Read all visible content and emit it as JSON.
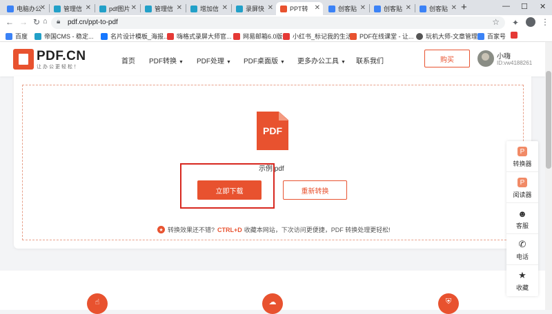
{
  "browser": {
    "tabs": [
      {
        "title": "电脑办公",
        "color": "#3b82f6"
      },
      {
        "title": "管理信",
        "color": "#22a0c8"
      },
      {
        "title": "pdf图片",
        "color": "#22a0c8"
      },
      {
        "title": "管理信",
        "color": "#22a0c8"
      },
      {
        "title": "增加信",
        "color": "#22a0c8"
      },
      {
        "title": "录屏快",
        "color": "#22a0c8"
      },
      {
        "title": "PPT转",
        "color": "#e8522f"
      },
      {
        "title": "创客贴",
        "color": "#3b82f6"
      },
      {
        "title": "创客贴",
        "color": "#3b82f6"
      },
      {
        "title": "创客贴",
        "color": "#3b82f6"
      }
    ],
    "url": "pdf.cn/ppt-to-pdf",
    "bookmarks": [
      {
        "label": "百度",
        "color": "#3b82f6"
      },
      {
        "label": "帝国CMS - 稳定...",
        "color": "#22a0c8"
      },
      {
        "label": "名片设计模板_海报...",
        "color": "#1677ff"
      },
      {
        "label": "嗨格式录屏大师官...",
        "color": "#e53935"
      },
      {
        "label": "网易邮箱6.0版",
        "color": "#e53935"
      },
      {
        "label": "小红书_标记我的生活",
        "color": "#e53935"
      },
      {
        "label": "PDF在线课堂 - 让...",
        "color": "#e8522f"
      },
      {
        "label": "玩机大师-文章管理",
        "color": "#555555"
      },
      {
        "label": "百家号",
        "color": "#3b82f6"
      }
    ]
  },
  "header": {
    "logo_text": "PDF.CN",
    "logo_sub": "让办公更轻松！",
    "nav": [
      {
        "label": "首页",
        "dropdown": false
      },
      {
        "label": "PDF转换",
        "dropdown": true
      },
      {
        "label": "PDF处理",
        "dropdown": true
      },
      {
        "label": "PDF桌面版",
        "dropdown": true
      },
      {
        "label": "更多办公工具",
        "dropdown": true
      },
      {
        "label": "联系我们",
        "dropdown": false
      }
    ],
    "buy_label": "购买",
    "user_name": "小嗨",
    "user_id": "ID:vw4188261"
  },
  "result": {
    "file_icon_label": "PDF",
    "file_name": "示例.pdf",
    "download_label": "立即下载",
    "reconvert_label": "重新转换",
    "tip_prefix": "转换效果还不错?",
    "tip_hotkey": "CTRL+D",
    "tip_suffix": "收藏本网站，下次访问更便捷，PDF 转换处理更轻松!"
  },
  "side_panel": [
    {
      "label": "转换器",
      "icon": "converter-icon"
    },
    {
      "label": "阅读器",
      "icon": "reader-icon"
    },
    {
      "label": "客服",
      "icon": "service-icon"
    },
    {
      "label": "电话",
      "icon": "phone-icon"
    },
    {
      "label": "收藏",
      "icon": "star-icon"
    }
  ],
  "features": [
    {
      "icon": "hand-pointer-icon"
    },
    {
      "icon": "cloud-icon"
    },
    {
      "icon": "shield-icon"
    }
  ],
  "colors": {
    "brand": "#e8522f",
    "highlight": "#d7261e"
  }
}
